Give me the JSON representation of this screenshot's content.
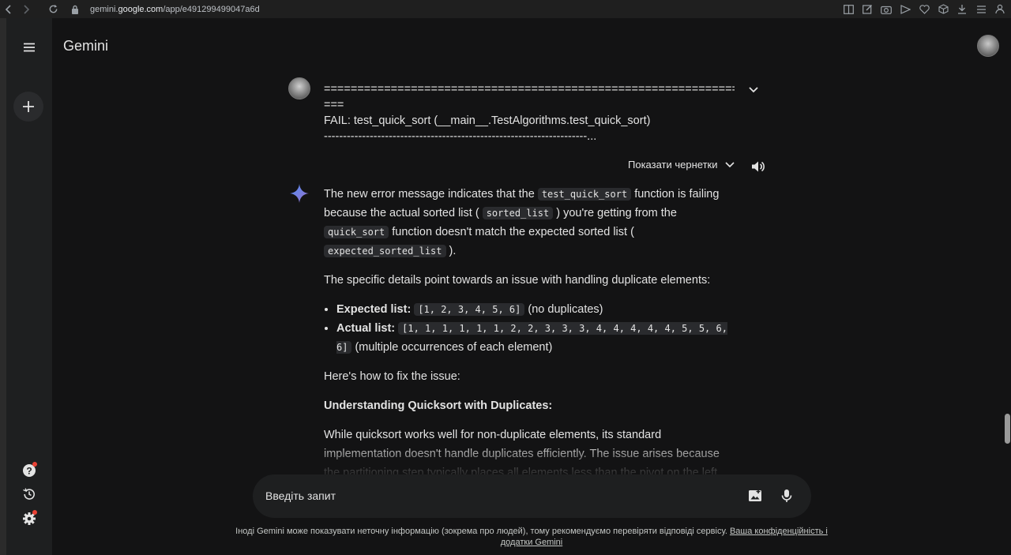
{
  "browser": {
    "url_prefix": "gemini.",
    "url_host": "google.com",
    "url_path": "/app/e491299499047a6d"
  },
  "app": {
    "title": "Gemini"
  },
  "user_message": {
    "line1": "=====================================================================",
    "line2": "===",
    "line3": "FAIL: test_quick_sort (__main__.TestAlgorithms.test_quick_sort)",
    "line4": "---------------------------------------------------------------------..."
  },
  "drafts": {
    "label": "Показати чернетки"
  },
  "response": {
    "p1_a": "The new error message indicates that the ",
    "p1_code1": "test_quick_sort",
    "p1_b": " function is failing because the actual sorted list ( ",
    "p1_code2": "sorted_list",
    "p1_c": " ) you're getting from the ",
    "p1_code3": "quick_sort",
    "p1_d": " function doesn't match the expected sorted list ( ",
    "p1_code4": "expected_sorted_list",
    "p1_e": " ).",
    "p2": "The specific details point towards an issue with handling duplicate elements:",
    "bullet1_label": "Expected list:",
    "bullet1_code": "[1, 2, 3, 4, 5, 6]",
    "bullet1_note": " (no duplicates)",
    "bullet2_label": "Actual list:",
    "bullet2_code": "[1, 1, 1, 1, 1, 1, 2, 2, 3, 3, 3, 4, 4, 4, 4, 4, 5, 5, 6, 6]",
    "bullet2_note": " (multiple occurrences of each element)",
    "p3": "Here's how to fix the issue:",
    "heading": "Understanding Quicksort with Duplicates:",
    "p4": "While quicksort works well for non-duplicate elements, its standard implementation doesn't handle duplicates efficiently. The issue arises because the partitioning step typically places all elements less than the pivot on the left and all elements greater than or equal to the pivot on the right. This can lead to placing duplicate elements in"
  },
  "prompt": {
    "placeholder": "Введіть запит"
  },
  "disclaimer": {
    "text": "Іноді Gemini може показувати неточну інформацію (зокрема про людей), тому рекомендуємо перевіряти відповіді сервісу. ",
    "link": "Ваша конфіденційність і додатки Gemini"
  },
  "colors": {
    "background": "#131314",
    "sidebar": "#1e1f20",
    "text": "#e3e3e3",
    "accent_blue": "#4285f4"
  },
  "icons": [
    "back-icon",
    "forward-icon",
    "reload-icon",
    "lock-icon",
    "menu-icon",
    "plus-icon",
    "help-icon",
    "history-icon",
    "settings-icon",
    "chevron-down-icon",
    "speaker-icon",
    "gemini-sparkle-icon",
    "image-icon",
    "mic-icon"
  ]
}
